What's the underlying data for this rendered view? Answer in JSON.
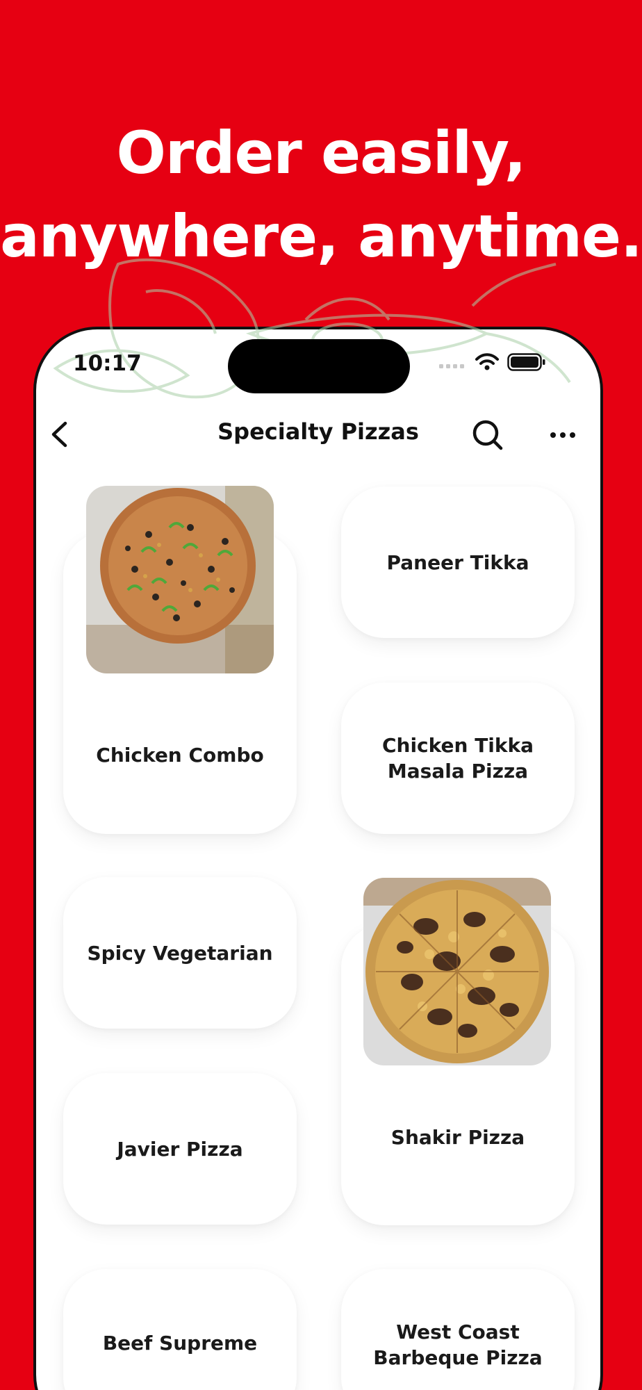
{
  "headline": {
    "line1": "Order easily,",
    "line2": "anywhere, anytime."
  },
  "status_bar": {
    "time": "10:17"
  },
  "nav": {
    "title": "Specialty Pizzas",
    "back_icon": "chevron-left-icon",
    "search_icon": "search-icon",
    "more_icon": "more-horizontal-icon"
  },
  "menu_items": [
    {
      "label": "Chicken Combo",
      "has_photo": true
    },
    {
      "label": "Paneer Tikka",
      "has_photo": false
    },
    {
      "label": "Chicken Tikka Masala Pizza",
      "has_photo": false
    },
    {
      "label": "Spicy Vegetarian",
      "has_photo": false
    },
    {
      "label": "Shakir Pizza",
      "has_photo": true
    },
    {
      "label": "Javier Pizza",
      "has_photo": false
    },
    {
      "label": "Beef Supreme",
      "has_photo": false
    },
    {
      "label": "West Coast Barbeque Pizza",
      "has_photo": false
    }
  ],
  "colors": {
    "brand_red": "#e60012",
    "card_bg": "#ffffff",
    "text_dark": "#1a1a1a"
  }
}
